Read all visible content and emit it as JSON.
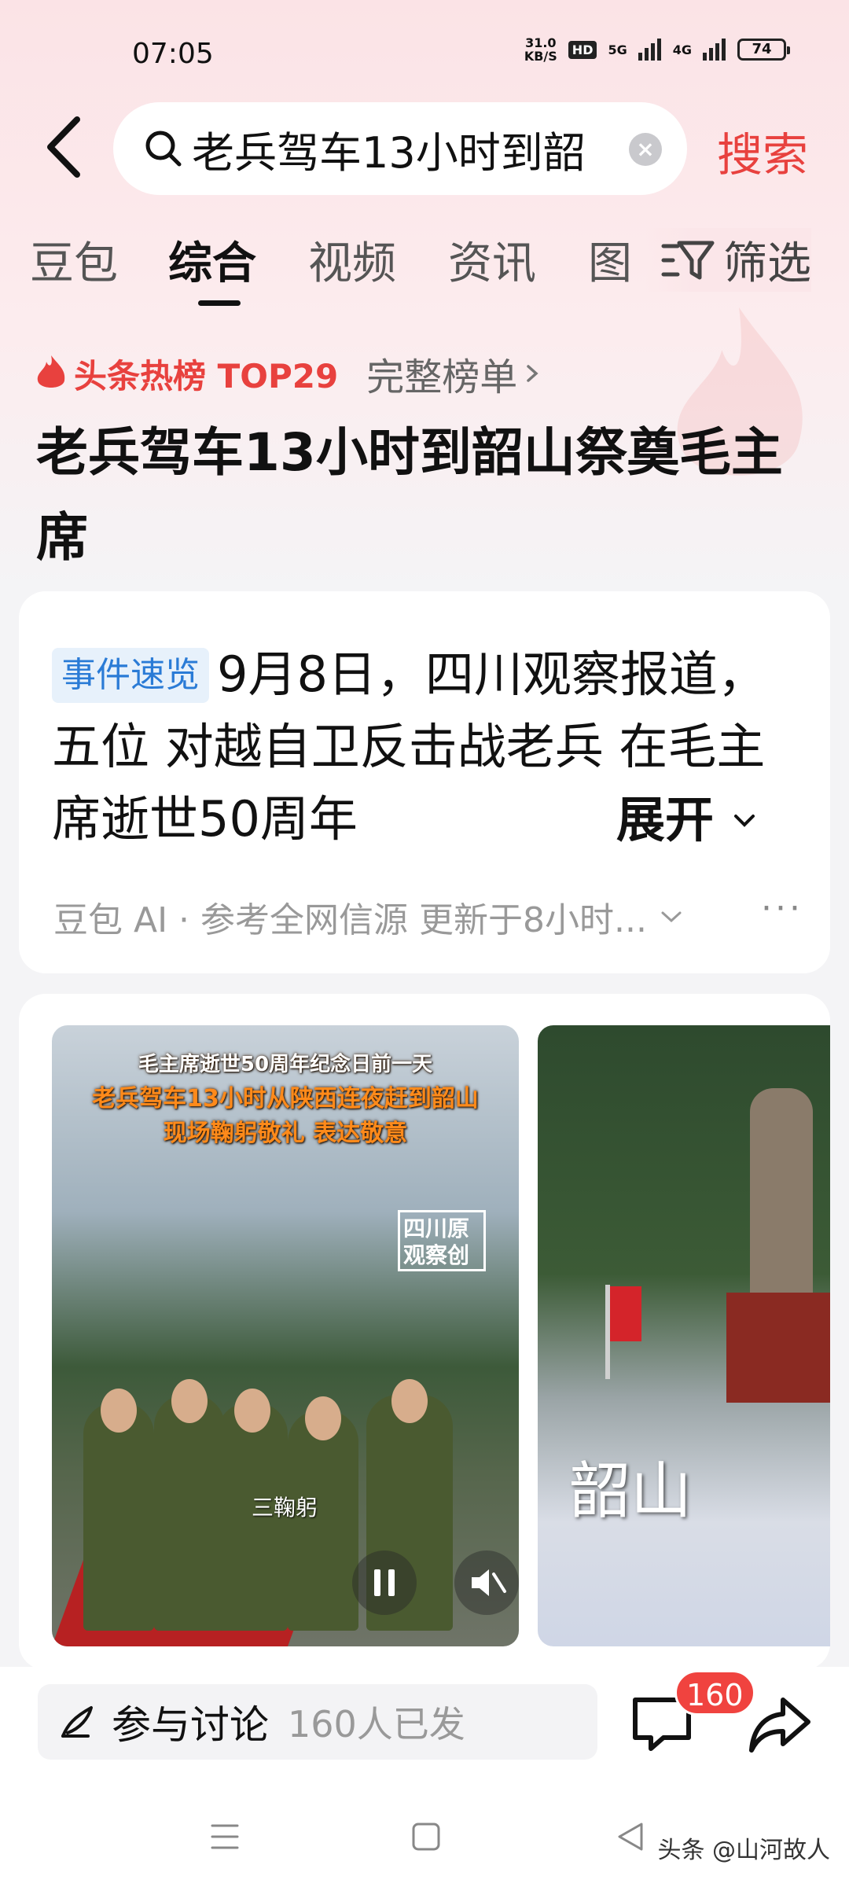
{
  "status_bar": {
    "time": "07:05",
    "net_speed_value": "31.0",
    "net_speed_unit": "KB/S",
    "hd_label": "HD",
    "signal_1": "5G",
    "signal_2": "4G",
    "battery": "74"
  },
  "search": {
    "query": "老兵驾车13小时到韶",
    "submit_label": "搜索"
  },
  "tabs": [
    {
      "label": "豆包",
      "active": false
    },
    {
      "label": "综合",
      "active": true
    },
    {
      "label": "视频",
      "active": false
    },
    {
      "label": "资讯",
      "active": false
    },
    {
      "label": "图",
      "active": false
    }
  ],
  "filter_label": "筛选",
  "hot": {
    "rank_label": "头条热榜 TOP29",
    "full_list_label": "完整榜单",
    "headline": "老兵驾车13小时到韶山祭奠毛主席"
  },
  "summary": {
    "tag": "事件速览",
    "text": "9月8日，四川观察报道，五位 对越自卫反击战老兵 在毛主席逝世50周年",
    "expand_label": "展开",
    "source_text": "豆包 AI · 参考全网信源 更新于8小时...",
    "more_icon": "more-icon"
  },
  "videos": [
    {
      "caption_top": "毛主席逝世50周年纪念日前一天",
      "caption_line1": "老兵驾车13小时从陕西连夜赶到韶山",
      "caption_line2": "现场鞠躬敬礼 表达敬意",
      "watermark_1": "四川",
      "watermark_2": "原",
      "watermark_3": "观察",
      "watermark_4": "创",
      "subtitle": "三鞠躬"
    },
    {
      "label": "韶山"
    }
  ],
  "bottom": {
    "discuss_label": "参与讨论",
    "discuss_count": "160人已发",
    "comment_badge": "160"
  },
  "nav": {
    "watermark": "头条 @山河故人"
  },
  "colors": {
    "accent_red": "#e8413e",
    "tag_blue": "#2a7bd6",
    "badge_red": "#f0433f"
  }
}
